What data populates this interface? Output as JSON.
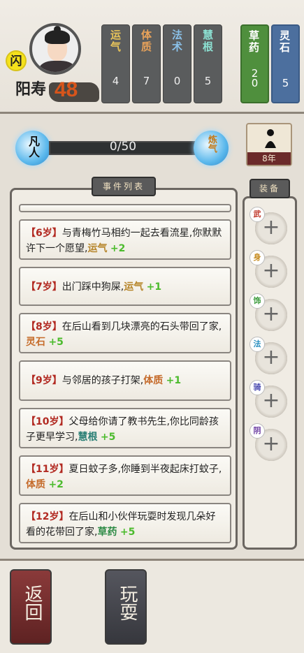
{
  "player": {
    "flash_badge": "闪",
    "lifespan_label": "阳寿",
    "lifespan_value": "48"
  },
  "stats": [
    {
      "label": "运气",
      "value": "4",
      "color": "#e8c45a"
    },
    {
      "label": "体质",
      "value": "7",
      "color": "#e8a25a"
    },
    {
      "label": "法术",
      "value": "0",
      "color": "#8ac0e8"
    },
    {
      "label": "慧根",
      "value": "5",
      "color": "#8ce0d2"
    }
  ],
  "resources": [
    {
      "label": "草药",
      "value": "2\n0",
      "color": "#4f8f3d"
    },
    {
      "label": "灵石",
      "value": "5",
      "color": "#4c6f9e"
    }
  ],
  "progress": {
    "left_orb": "凡人",
    "right_orb": "炼气",
    "text": "0/50",
    "fraction": 0.0
  },
  "meditate": {
    "caption": "8年"
  },
  "events": {
    "title": "事件列表",
    "items": [
      {
        "age": "【6岁】",
        "text": "与青梅竹马相约一起去看流星,你默默许下一个愿望,",
        "stat": "运气",
        "stat_class": "kw-luck",
        "delta": "+2"
      },
      {
        "age": "【7岁】",
        "text": "出门踩中狗屎,",
        "stat": "运气",
        "stat_class": "kw-luck",
        "delta": "+1"
      },
      {
        "age": "【8岁】",
        "text": "在后山看到几块漂亮的石头带回了家,",
        "stat": "灵石",
        "stat_class": "kw-stone",
        "delta": "+5"
      },
      {
        "age": "【9岁】",
        "text": "与邻居的孩子打架,",
        "stat": "体质",
        "stat_class": "kw-con",
        "delta": "+1"
      },
      {
        "age": "【10岁】",
        "text": "父母给你请了教书先生,你比同龄孩子更早学习,",
        "stat": "慧根",
        "stat_class": "kw-root",
        "delta": "+5"
      },
      {
        "age": "【11岁】",
        "text": "夏日蚊子多,你睡到半夜起床打蚊子,",
        "stat": "体质",
        "stat_class": "kw-con",
        "delta": "+2"
      },
      {
        "age": "【12岁】",
        "text": "在后山和小伙伴玩耍时发现几朵好看的花带回了家,",
        "stat": "草药",
        "stat_class": "kw-herb",
        "delta": "+5"
      }
    ]
  },
  "equipment": {
    "title": "装备",
    "slots": [
      {
        "tag": "武",
        "color": "#c0392b"
      },
      {
        "tag": "身",
        "color": "#c58a1e"
      },
      {
        "tag": "饰",
        "color": "#3a9a3a"
      },
      {
        "tag": "法",
        "color": "#2a8fc0"
      },
      {
        "tag": "骑",
        "color": "#4a4ab0"
      },
      {
        "tag": "阴",
        "color": "#6a3aa0"
      }
    ],
    "plus": "+"
  },
  "buttons": {
    "back": "返回",
    "play": "玩耍"
  }
}
